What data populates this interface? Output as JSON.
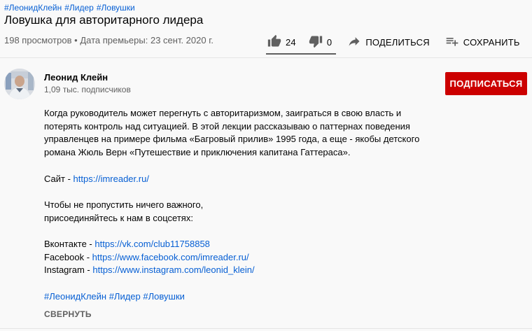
{
  "video": {
    "tags": [
      "#ЛеонидКлейн",
      "#Лидер",
      "#Ловушки"
    ],
    "title": "Ловушка для авторитарного лидера",
    "views": "198 просмотров",
    "dot": "•",
    "premiere": "Дата премьеры: 23 сент. 2020 г."
  },
  "actions": {
    "like_count": "24",
    "dislike_count": "0",
    "share_label": "ПОДЕЛИТЬСЯ",
    "save_label": "СОХРАНИТЬ",
    "like_ratio": 1.0
  },
  "channel": {
    "name": "Леонид Клейн",
    "subscribers": "1,09 тыс. подписчиков",
    "subscribe_label": "ПОДПИСАТЬСЯ"
  },
  "description": {
    "lines": [
      "Когда руководитель может перегнуть с авторитаризмом, заиграться в свою власть и",
      "потерять контроль над ситуацией. В этой лекции рассказываю о паттернах поведения",
      "управленцев на примере фильма «Багровый прилив» 1995 года, а еще - якобы детского",
      "романа Жюль Верн «Путешествие и приключения капитана Гаттераса»."
    ],
    "site_label": "Сайт - ",
    "site_url": "https://imreader.ru/",
    "join_lines": [
      "Чтобы не пропустить ничего важного,",
      "присоединяйтесь к нам в соцсетях:"
    ],
    "socials": [
      {
        "label": "Вконтакте - ",
        "url": "https://vk.com/club11758858"
      },
      {
        "label": "Facebook - ",
        "url": "https://www.facebook.com/imreader.ru/"
      },
      {
        "label": "Instagram - ",
        "url": "https://www.instagram.com/leonid_klein/"
      }
    ],
    "hashtags": [
      "#ЛеонидКлейн",
      "#Лидер",
      "#Ловушки"
    ],
    "collapse_label": "СВЕРНУТЬ"
  },
  "colors": {
    "link": "#065fd4",
    "subscribe_bg": "#cc0000",
    "secondary_text": "#606060"
  }
}
